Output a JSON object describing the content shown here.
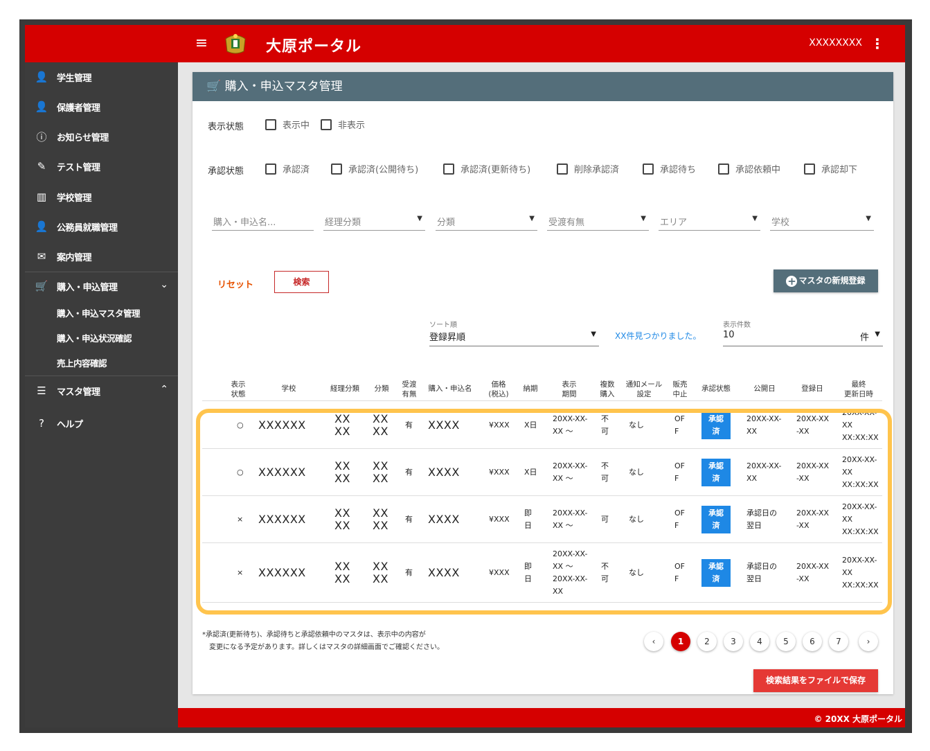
{
  "app": {
    "title": "大原ポータル",
    "user": "XXXXXXXX",
    "footer": "© 20XX 大原ポータル"
  },
  "sidebar": {
    "items": [
      {
        "label": "学生管理",
        "icon": "person-icon"
      },
      {
        "label": "保護者管理",
        "icon": "person-icon"
      },
      {
        "label": "お知らせ管理",
        "icon": "info-icon"
      },
      {
        "label": "テスト管理",
        "icon": "pencil-icon"
      },
      {
        "label": "学校管理",
        "icon": "building-icon"
      },
      {
        "label": "公務員就職管理",
        "icon": "person-icon"
      },
      {
        "label": "案内管理",
        "icon": "mail-icon"
      },
      {
        "label": "購入・申込管理",
        "icon": "cart-icon"
      }
    ],
    "sub_items": [
      "購入・申込マスタ管理",
      "購入・申込状況確認",
      "売上内容確認"
    ],
    "master": "マスタ管理",
    "help": "ヘルプ"
  },
  "page": {
    "title": "購入・申込マスタ管理",
    "display_status": {
      "label": "表示状態",
      "options": [
        "表示中",
        "非表示"
      ]
    },
    "approval_status": {
      "label": "承認状態",
      "options": [
        "承認済",
        "承認済(公開待ち)",
        "承認済(更新待ち)",
        "削除承認済",
        "承認待ち",
        "承認依頼中",
        "承認却下"
      ]
    },
    "filters": {
      "name_placeholder": "購入・申込名...",
      "accounting": "経理分類",
      "category": "分類",
      "delivery": "受渡有無",
      "area": "エリア",
      "school": "学校"
    },
    "buttons": {
      "reset": "リセット",
      "search": "検索",
      "new_master": "マスタの新規登録",
      "save": "検索結果をファイルで保存"
    },
    "sort": {
      "label": "ソート順",
      "value": "登録昇順"
    },
    "found": "XX件見つかりました。",
    "per_page": {
      "label": "表示件数",
      "value": "10",
      "unit": "件"
    },
    "note": [
      "*承認済(更新待ち)、承認待ちと承認依頼中のマスタは、表示中の内容が",
      "変更になる予定があります。詳しくはマスタの詳細画面でご確認ください。"
    ],
    "pages": [
      "1",
      "2",
      "3",
      "4",
      "5",
      "6",
      "7"
    ]
  },
  "table": {
    "headers": [
      [
        "表示",
        "状態"
      ],
      [
        "学校"
      ],
      [
        "経理分類"
      ],
      [
        "分類"
      ],
      [
        "受渡",
        "有無"
      ],
      [
        "購入・申込名"
      ],
      [
        "価格",
        "(税込)"
      ],
      [
        "納期"
      ],
      [
        "表示",
        "期間"
      ],
      [
        "複数",
        "購入"
      ],
      [
        "通知メール",
        "設定"
      ],
      [
        "販売",
        "中止"
      ],
      [
        "承認状態"
      ],
      [
        "公開日"
      ],
      [
        "登録日"
      ],
      [
        "最終",
        "更新日時"
      ]
    ],
    "rows": [
      {
        "status": "○",
        "school": "XXXXXX",
        "acc": [
          "XX",
          "XX"
        ],
        "cat": [
          "XX",
          "XX"
        ],
        "deliv": "有",
        "name": "XXXX",
        "price": "¥XXX",
        "due": [
          "X日"
        ],
        "period": [
          "20XX-XX-",
          "XX ～"
        ],
        "multi": [
          "不",
          "可"
        ],
        "mail": "なし",
        "stop": [
          "OF",
          "F"
        ],
        "approval": [
          "承認",
          "済"
        ],
        "pub": [
          "20XX-XX-",
          "XX"
        ],
        "reg": [
          "20XX-XX",
          "-XX"
        ],
        "upd": [
          "20XX-XX-",
          "XX",
          "XX:XX:XX"
        ]
      },
      {
        "status": "○",
        "school": "XXXXXX",
        "acc": [
          "XX",
          "XX"
        ],
        "cat": [
          "XX",
          "XX"
        ],
        "deliv": "有",
        "name": "XXXX",
        "price": "¥XXX",
        "due": [
          "X日"
        ],
        "period": [
          "20XX-XX-",
          "XX ～"
        ],
        "multi": [
          "不",
          "可"
        ],
        "mail": "なし",
        "stop": [
          "OF",
          "F"
        ],
        "approval": [
          "承認",
          "済"
        ],
        "pub": [
          "20XX-XX-",
          "XX"
        ],
        "reg": [
          "20XX-XX",
          "-XX"
        ],
        "upd": [
          "20XX-XX-",
          "XX",
          "XX:XX:XX"
        ]
      },
      {
        "status": "×",
        "school": "XXXXXX",
        "acc": [
          "XX",
          "XX"
        ],
        "cat": [
          "XX",
          "XX"
        ],
        "deliv": "有",
        "name": "XXXX",
        "price": "¥XXX",
        "due": [
          "即",
          "日"
        ],
        "period": [
          "20XX-XX-",
          "XX ～"
        ],
        "multi": [
          "可"
        ],
        "mail": "なし",
        "stop": [
          "OF",
          "F"
        ],
        "approval": [
          "承認",
          "済"
        ],
        "pub": [
          "承認日の",
          "翌日"
        ],
        "reg": [
          "20XX-XX",
          "-XX"
        ],
        "upd": [
          "20XX-XX-",
          "XX",
          "XX:XX:XX"
        ]
      },
      {
        "status": "×",
        "school": "XXXXXX",
        "acc": [
          "XX",
          "XX"
        ],
        "cat": [
          "XX",
          "XX"
        ],
        "deliv": "有",
        "name": "XXXX",
        "price": "¥XXX",
        "due": [
          "即",
          "日"
        ],
        "period": [
          "20XX-XX-",
          "XX ～",
          "20XX-XX-",
          "XX"
        ],
        "multi": [
          "不",
          "可"
        ],
        "mail": "なし",
        "stop": [
          "OF",
          "F"
        ],
        "approval": [
          "承認",
          "済"
        ],
        "pub": [
          "承認日の",
          "翌日"
        ],
        "reg": [
          "20XX-XX",
          "-XX"
        ],
        "upd": [
          "20XX-XX-",
          "XX",
          "XX:XX:XX"
        ]
      }
    ]
  },
  "colors": {
    "brand_red": "#d50000",
    "header_slate": "#546e7a",
    "approval_blue": "#1e88e5",
    "highlight": "#ffc44d"
  }
}
